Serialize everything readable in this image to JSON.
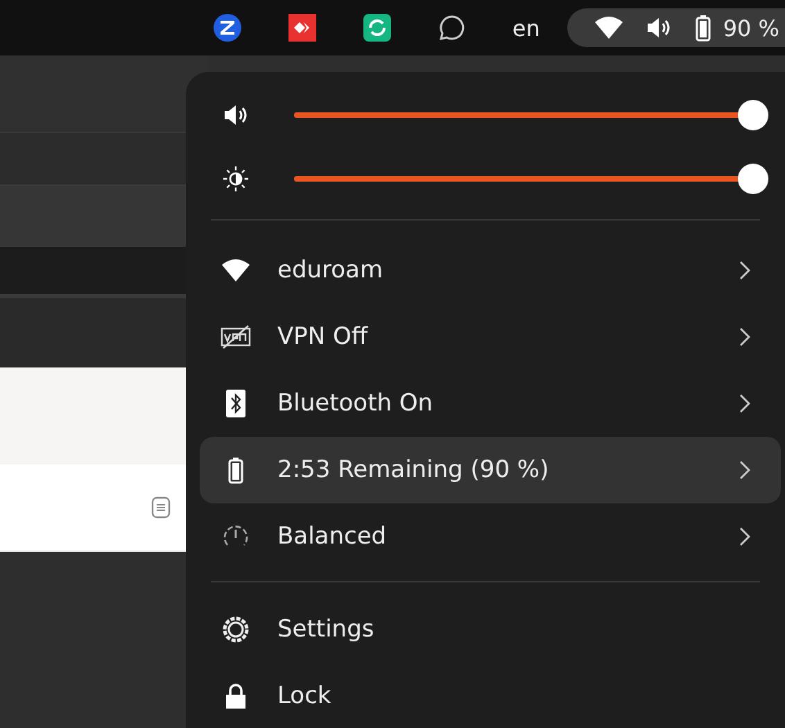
{
  "top_bar": {
    "language": "en",
    "battery_percent": "90 %"
  },
  "quick_menu": {
    "sliders": [
      {
        "kind": "volume",
        "level": 1.0
      },
      {
        "kind": "brightness",
        "level": 1.0
      }
    ],
    "items": [
      {
        "kind": "wifi",
        "label": "eduroam",
        "selected": false
      },
      {
        "kind": "vpn",
        "label": "VPN Off",
        "selected": false
      },
      {
        "kind": "bluetooth",
        "label": "Bluetooth On",
        "selected": false
      },
      {
        "kind": "battery",
        "label": "2:53 Remaining (90 %)",
        "selected": true
      },
      {
        "kind": "power",
        "label": "Balanced",
        "selected": false
      }
    ],
    "actions": [
      {
        "kind": "settings",
        "label": "Settings"
      },
      {
        "kind": "lock",
        "label": "Lock"
      }
    ]
  }
}
